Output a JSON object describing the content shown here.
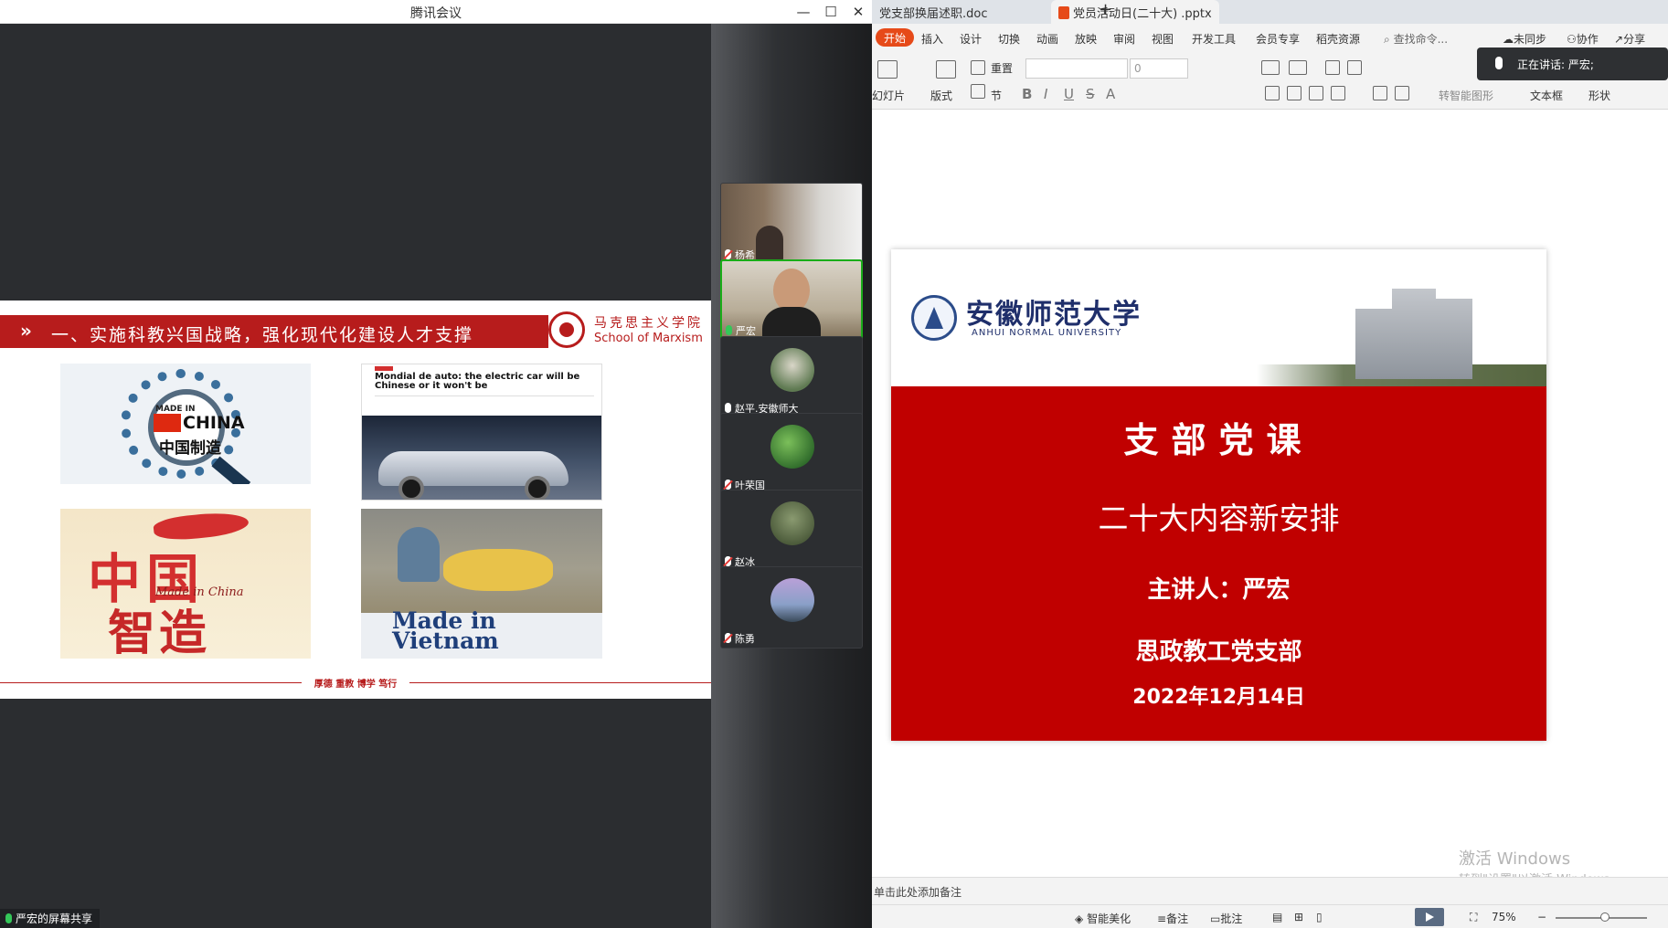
{
  "tencent_meeting": {
    "title": "腾讯会议",
    "window_controls": {
      "minimize": "—",
      "maximize": "☐",
      "close": "✕"
    },
    "shared_slide": {
      "heading": "一、实施科教兴国战略，强化现代化建设人才支撑",
      "school_cn": "马克思主义学院",
      "school_en": "School of Marxism",
      "footer": "厚德 重教 博学 笃行",
      "images": {
        "made_in_china": {
          "top_text": "MADE IN",
          "china": "CHINA",
          "cn": "中国制造"
        },
        "news": {
          "headline": "Mondial de auto: the electric car will be Chinese or it won't be"
        },
        "zhizao": {
          "cn_top": "中国",
          "cn_bottom": "智造",
          "script": "Made in China"
        },
        "vietnam": {
          "label": "Made in Vietnam"
        }
      }
    },
    "share_indicator": "严宏的屏幕共享",
    "participants": [
      {
        "name": "杨希",
        "mic": "off",
        "video": true
      },
      {
        "name": "严宏",
        "mic": "on",
        "video": true,
        "active": true
      },
      {
        "name": "赵平.安徽师大",
        "mic": "on",
        "video": false
      },
      {
        "name": "叶荣国",
        "mic": "off",
        "video": false
      },
      {
        "name": "赵冰",
        "mic": "off",
        "video": false
      },
      {
        "name": "陈勇",
        "mic": "off",
        "video": false
      }
    ]
  },
  "wps": {
    "doc_tabs": [
      {
        "label": "党支部换届述职.doc"
      },
      {
        "label": "党员活动日(二十大) .pptx",
        "active": true
      }
    ],
    "new_tab": "+",
    "ribbon_tabs": [
      "开始",
      "插入",
      "设计",
      "切换",
      "动画",
      "放映",
      "审阅",
      "视图",
      "开发工具",
      "会员专享",
      "稻壳资源"
    ],
    "search": "查找命令...",
    "right_actions": {
      "unsync": "未同步",
      "collab": "协作",
      "share": "分享"
    },
    "ribbon": {
      "new_slide": "幻灯片",
      "layout": "版式",
      "section": "节",
      "reset": "重置",
      "font_size": "0",
      "smartart": "转智能图形",
      "textbox": "文本框",
      "shape": "形状"
    },
    "speaking": "正在讲话: 严宏;",
    "slide": {
      "university_cn": "安徽师范大学",
      "university_en": "ANHUI NORMAL UNIVERSITY",
      "title": "支部党课",
      "subtitle": "二十大内容新安排",
      "speaker": "主讲人：严宏",
      "branch": "思政教工党支部",
      "date": "2022年12月14日"
    },
    "watermark": {
      "line1": "激活 Windows",
      "line2": "转到\"设置\"以激活 Windows。"
    },
    "notes_placeholder": "单击此处添加备注",
    "status": {
      "beautify": "智能美化",
      "notes": "备注",
      "comments": "批注",
      "zoom": "75%"
    }
  }
}
